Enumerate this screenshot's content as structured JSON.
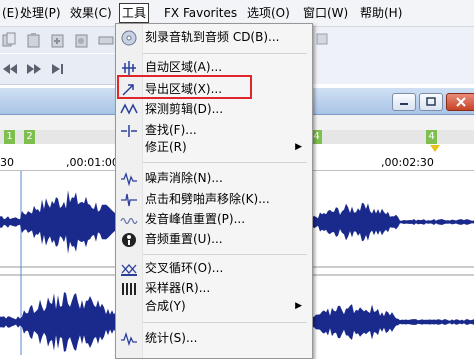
{
  "menubar": {
    "items": [
      "(E)",
      "处理(P)",
      "效果(C)",
      "工具",
      "FX Favorites",
      "选项(O)",
      "窗口(W)",
      "帮助(H)"
    ]
  },
  "ruler": {
    "markers": [
      "1",
      "2",
      "4",
      "4"
    ],
    "times": [
      "30",
      ",00:01:00",
      ",00:02:30"
    ]
  },
  "tools_menu": {
    "items": [
      {
        "label": "刻录音轨到音频 CD(B)...",
        "icon": "cd-burn-icon",
        "submenu": false
      },
      {
        "label": "自动区域(A)...",
        "icon": "auto-region-icon",
        "submenu": false
      },
      {
        "label": "导出区域(X)...",
        "icon": "export-region-icon",
        "submenu": false
      },
      {
        "label": "探测剪辑(D)...",
        "icon": "detect-clipping-icon",
        "submenu": false
      },
      {
        "label": "查找(F)...",
        "icon": "find-icon",
        "submenu": false
      },
      {
        "label": "修正(R)",
        "icon": "",
        "submenu": true
      },
      {
        "label": "噪声消除(N)...",
        "icon": "noise-reduction-icon",
        "submenu": false
      },
      {
        "label": "点击和劈啪声移除(K)...",
        "icon": "click-pop-removal-icon",
        "submenu": false
      },
      {
        "label": "发音峰值重置(P)...",
        "icon": "peak-reset-icon",
        "submenu": false
      },
      {
        "label": "音频重置(U)...",
        "icon": "audio-reset-icon",
        "submenu": false
      },
      {
        "label": "交叉循环(O)...",
        "icon": "crossfade-loop-icon",
        "submenu": false
      },
      {
        "label": "采样器(R)...",
        "icon": "sampler-icon",
        "submenu": false
      },
      {
        "label": "合成(Y)",
        "icon": "",
        "submenu": true
      },
      {
        "label": "统计(S)...",
        "icon": "statistics-icon",
        "submenu": false
      }
    ]
  },
  "colors": {
    "highlight_box": "#e0262a",
    "waveform": "#1a2a8c",
    "marker": "#7fbf4f",
    "title_strip": "#a9c4e6"
  }
}
